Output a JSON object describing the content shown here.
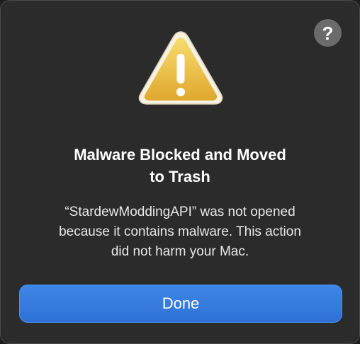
{
  "dialog": {
    "help_label": "?",
    "icon": "warning-triangle-icon",
    "title_lines": [
      "Malware Blocked and Moved",
      "to Trash"
    ],
    "message_lines": [
      "“StardewModdingAPI” was not opened",
      "because it contains malware. This action",
      "did not harm your Mac."
    ],
    "done_label": "Done"
  },
  "colors": {
    "background": "#2b2b2b",
    "accent": "#3478e0",
    "warning": "#f2c94c"
  }
}
